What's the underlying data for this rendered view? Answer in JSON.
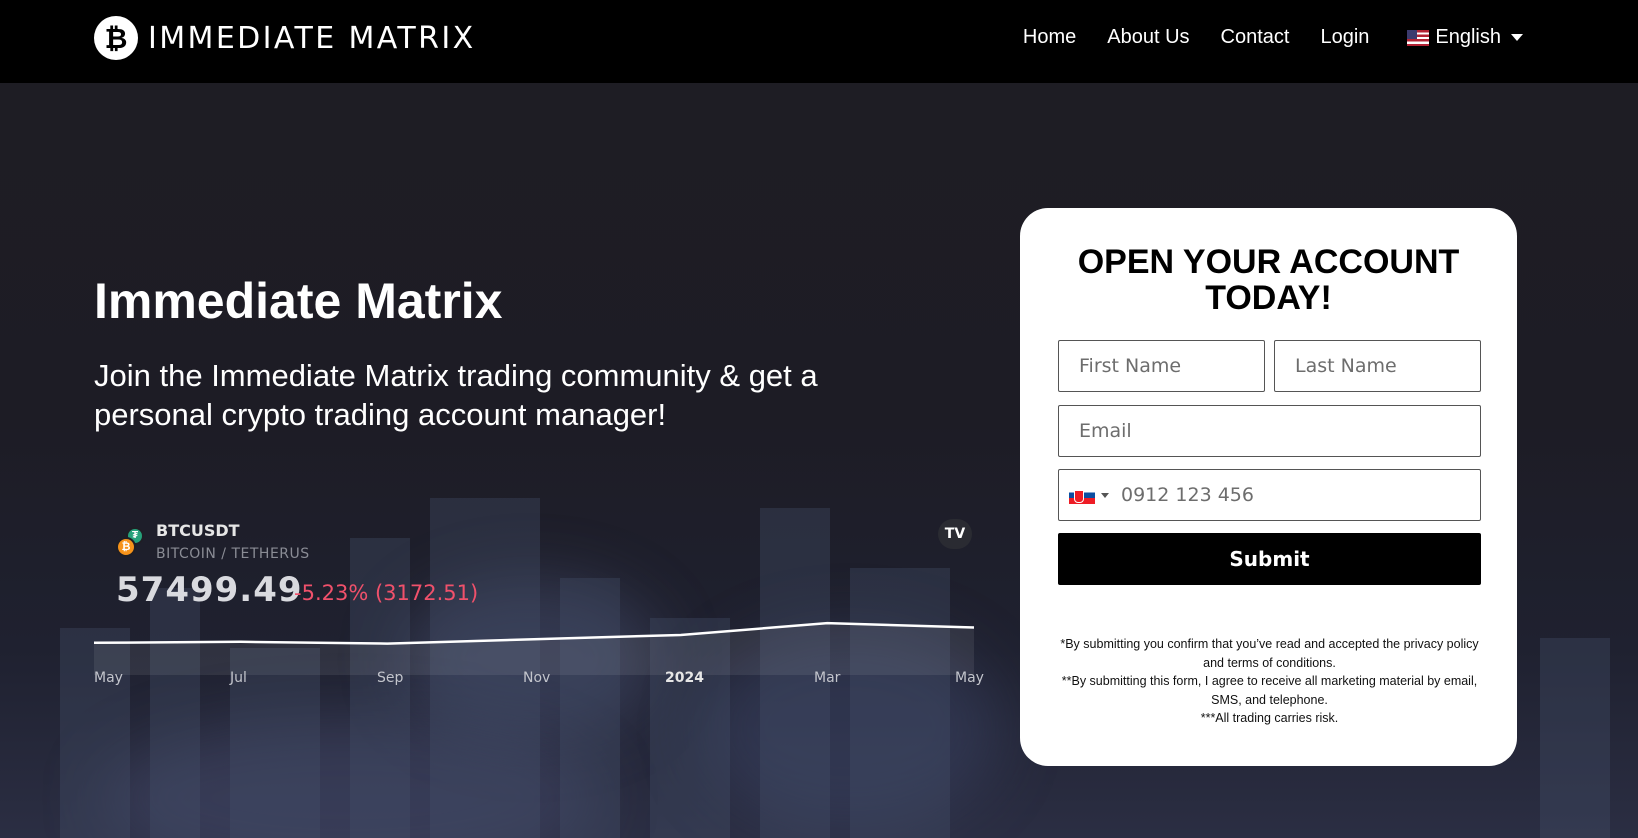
{
  "brand": {
    "logo_glyph": "₿",
    "name": "IMMEDIATE MATRIX"
  },
  "nav": {
    "items": [
      "Home",
      "About Us",
      "Contact",
      "Login"
    ],
    "language": "English"
  },
  "hero": {
    "title": "Immediate Matrix",
    "subtitle": "Join the Immediate Matrix trading community & get a personal crypto trading account manager!"
  },
  "ticker": {
    "symbol": "BTCUSDT",
    "pair": "BITCOIN / TETHERUS",
    "price": "57499.49",
    "change": "-5.23% (3172.51)",
    "tv_glyph": "TV",
    "months": [
      "May",
      "Jul",
      "Sep",
      "Nov",
      "2024",
      "Mar",
      "May"
    ],
    "line_color": "#ffffff",
    "change_color": "#f0516b"
  },
  "chart_data": {
    "type": "line",
    "x": [
      "May",
      "Jul",
      "Sep",
      "Nov",
      "2024",
      "Mar",
      "May"
    ],
    "series": [
      {
        "values": [
          28000,
          30000,
          26500,
          35000,
          43000,
          66000,
          57499
        ]
      }
    ]
  },
  "form": {
    "title": "OPEN YOUR ACCOUNT TODAY!",
    "first_name_placeholder": "First Name",
    "last_name_placeholder": "Last Name",
    "email_placeholder": "Email",
    "phone_placeholder": "0912 123 456",
    "submit_label": "Submit",
    "disclaimer": [
      "*By submitting you confirm that you’ve read and accepted the privacy policy and terms of conditions.",
      "**By submitting this form, I agree to receive all marketing material by email, SMS, and telephone.",
      "***All trading carries risk."
    ]
  }
}
